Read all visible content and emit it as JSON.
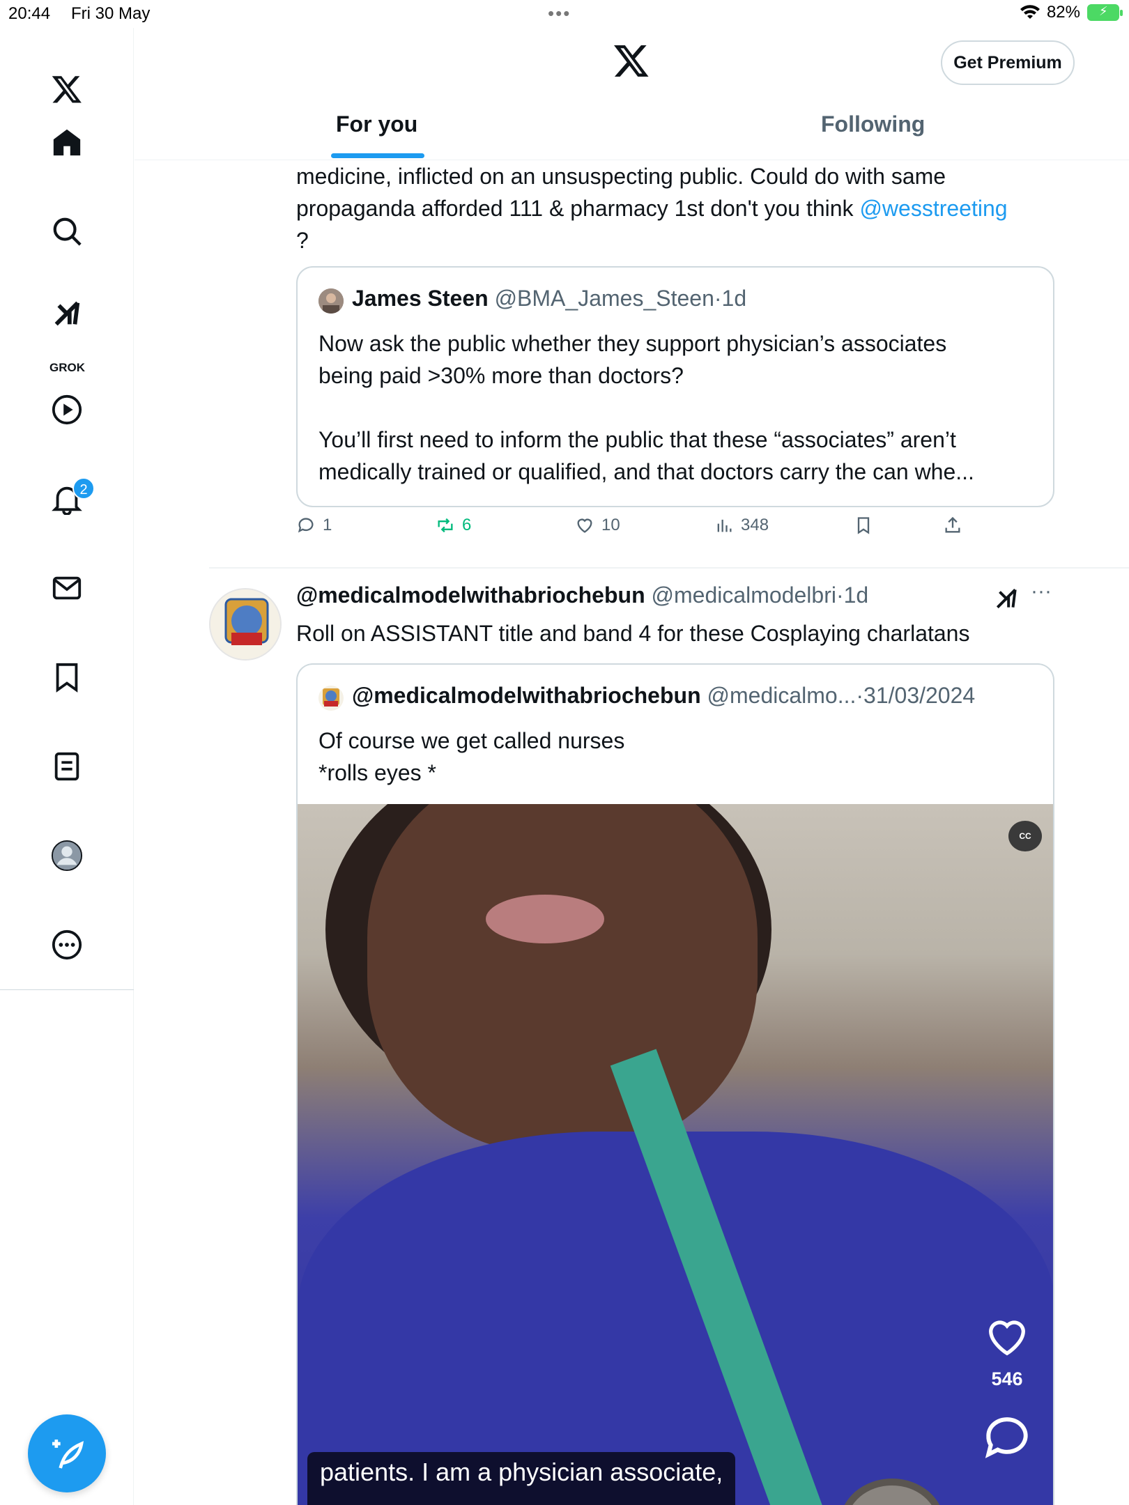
{
  "status_bar": {
    "time": "20:44",
    "date": "Fri 30 May",
    "battery": "82%"
  },
  "sidebar": {
    "items": [
      {
        "name": "home"
      },
      {
        "name": "explore"
      },
      {
        "name": "grok",
        "label": "GROK"
      },
      {
        "name": "videos"
      },
      {
        "name": "notifications",
        "badge": "2"
      },
      {
        "name": "messages"
      },
      {
        "name": "bookmarks"
      },
      {
        "name": "lists"
      },
      {
        "name": "profile"
      },
      {
        "name": "more"
      }
    ]
  },
  "header": {
    "premium_label": "Get Premium",
    "tabs": [
      {
        "label": "For you",
        "active": true
      },
      {
        "label": "Following",
        "active": false
      }
    ]
  },
  "post1": {
    "text_line1": "medicine,  inflicted on an unsuspecting public. Could do with same",
    "text_line2_a": "propaganda afforded 111 & pharmacy 1st don't you think ",
    "mention": "@wesstreeting",
    "text_line3": "?",
    "quote": {
      "name": "James Steen",
      "handle": "@BMA_James_Steen",
      "sep": "·",
      "time": "1d",
      "line1": "Now ask the public whether they support physician’s associates",
      "line2": "being paid >30% more than doctors?",
      "line3": "You’ll first need to inform the public that these “associates” aren’t",
      "line4": "medically trained or qualified, and that doctors carry the can whe..."
    },
    "actions": {
      "replies": "1",
      "reposts": "6",
      "likes": "10",
      "views": "348"
    }
  },
  "post2": {
    "name": "@medicalmodelwithabriochebun",
    "handle": "@medicalmodelbri",
    "sep": "·",
    "time": "1d",
    "more": "···",
    "text": "Roll on ASSISTANT title and band 4 for these Cosplaying charlatans",
    "quote": {
      "name": "@medicalmodelwithabriochebun",
      "handle": "@medicalmo...",
      "sep": "·",
      "time": "31/03/2024",
      "line1": "Of course we get called nurses",
      "line2": "*rolls eyes *"
    },
    "video": {
      "cc_label": "CC",
      "like_count": "546",
      "caption": "patients. I am a physician associate,"
    }
  }
}
